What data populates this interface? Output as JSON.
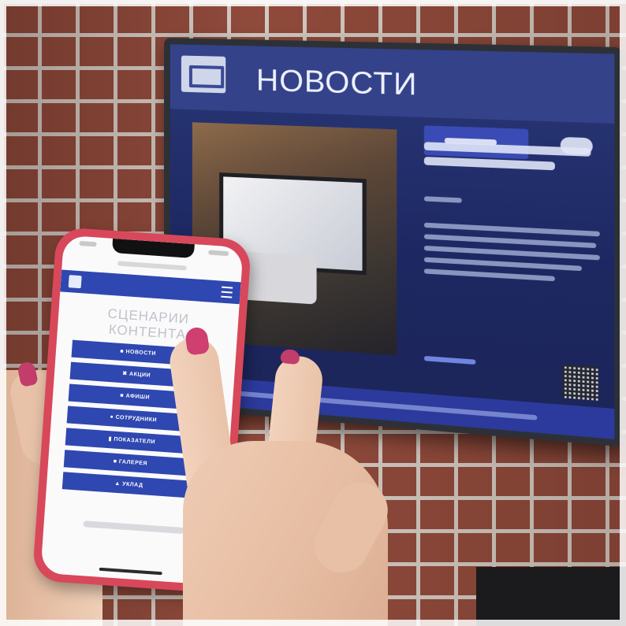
{
  "tv": {
    "header_title": "НОВОСТИ"
  },
  "phone": {
    "heading_line1": "СЦЕНАРИИ",
    "heading_line2": "КОНТЕНТА",
    "buttons": [
      {
        "label": "■ НОВОСТИ"
      },
      {
        "label": "✖ АКЦИИ"
      },
      {
        "label": "■ АФИШИ"
      },
      {
        "label": "● СОТРУДНИКИ"
      },
      {
        "label": "▮ ПОКАЗАТЕЛИ"
      },
      {
        "label": "■ ГАЛЕРЕЯ"
      },
      {
        "label": "▲ УКЛАД"
      }
    ]
  },
  "colors": {
    "accent_blue": "#2f47b0",
    "tv_background": "#1d2862",
    "phone_case": "#d8485a",
    "nail_polish": "#cf3f6f",
    "brick": "#8f4a3b"
  },
  "icons": {
    "tv_logo": "company-logo-icon",
    "phone_logo": "company-logo-icon",
    "phone_menu": "hamburger-menu-icon",
    "tv_qr": "qr-code-icon"
  }
}
